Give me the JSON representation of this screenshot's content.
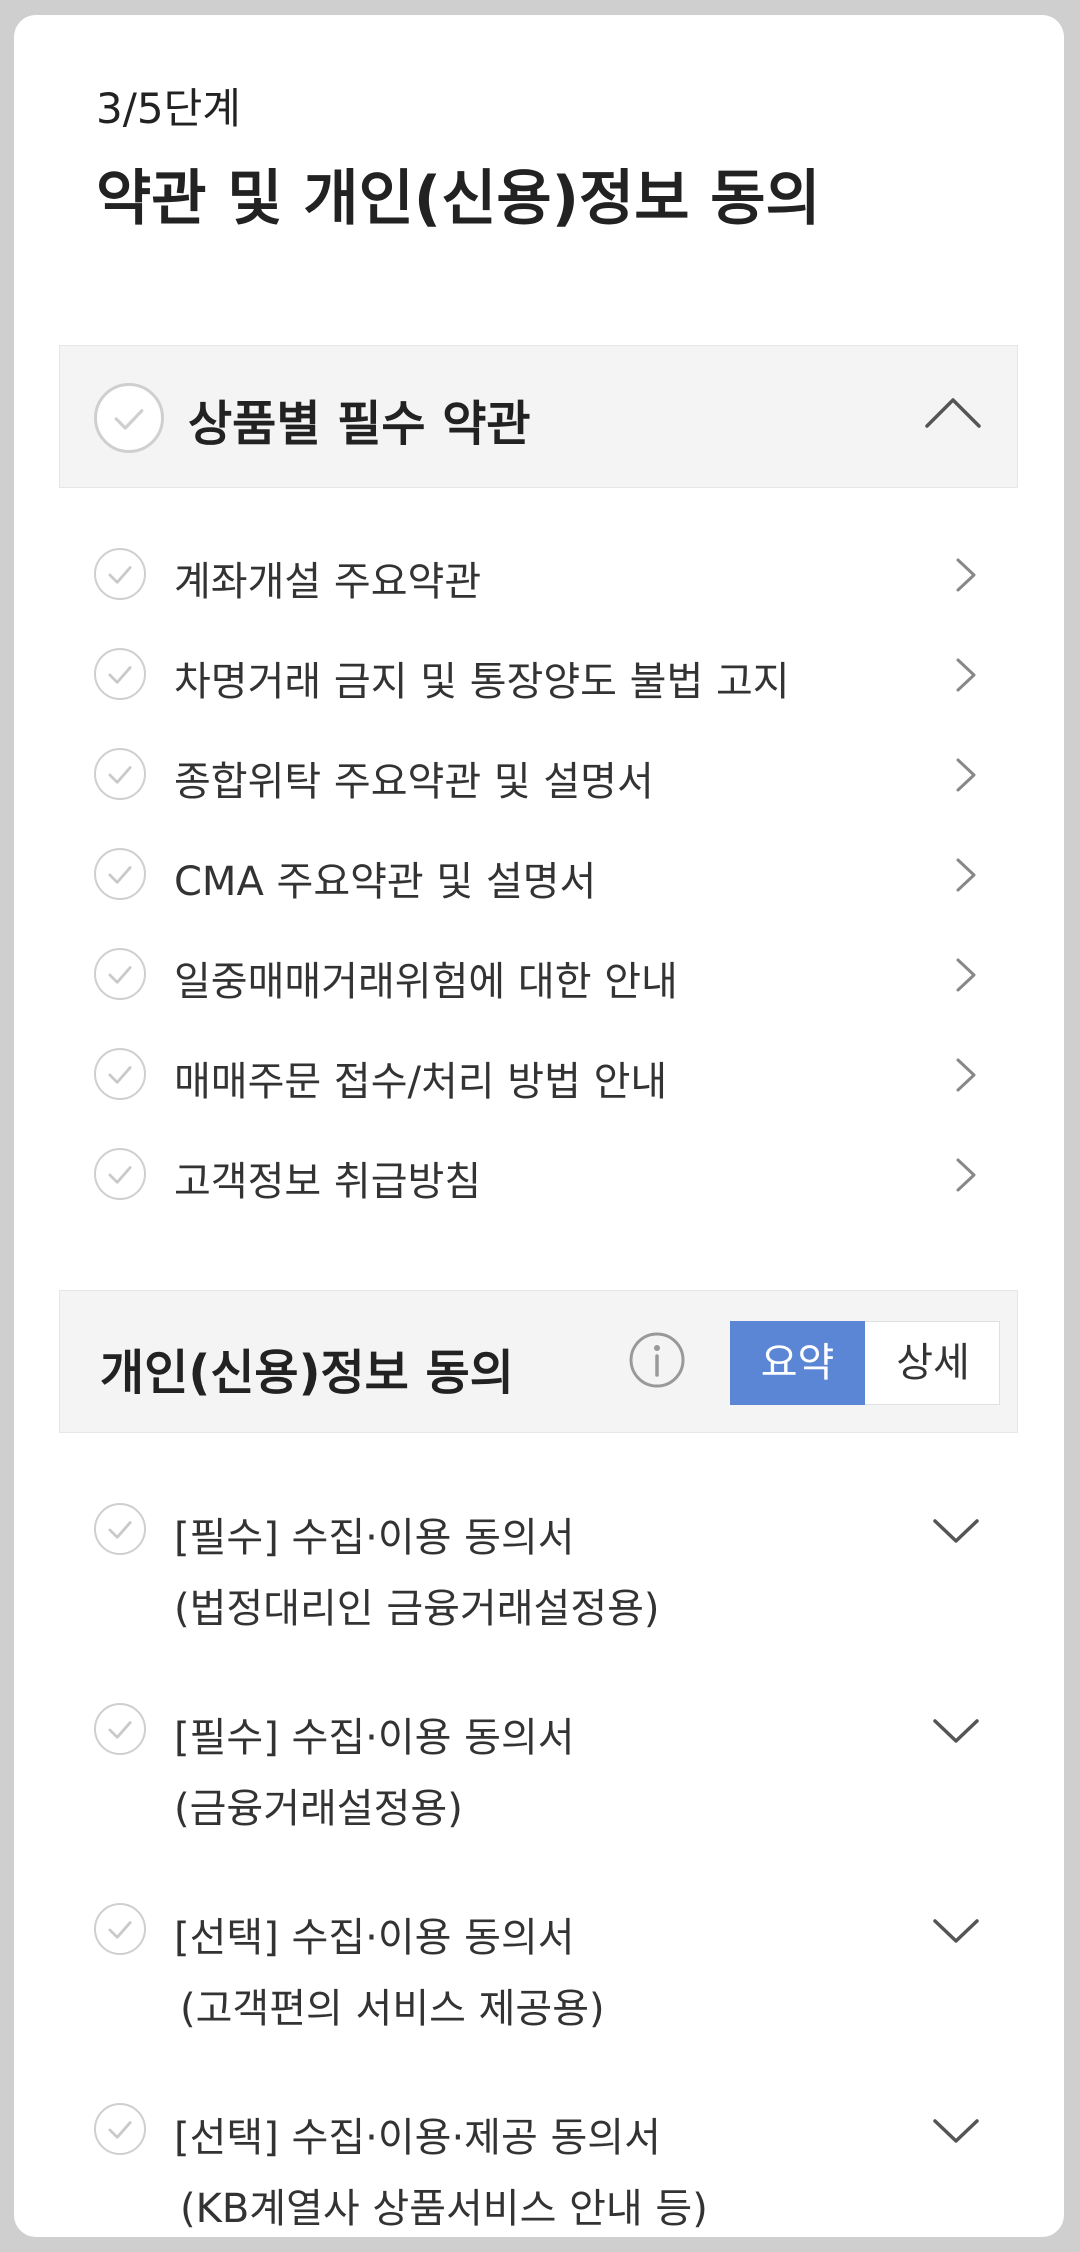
{
  "header": {
    "step": "3/5단계",
    "title": "약관 및 개인(신용)정보 동의"
  },
  "section1": {
    "title": "상품별 필수 약관",
    "items": [
      {
        "label": "계좌개설 주요약관"
      },
      {
        "label": "차명거래 금지 및 통장양도 불법 고지"
      },
      {
        "label": "종합위탁 주요약관 및 설명서"
      },
      {
        "label": "CMA 주요약관 및 설명서"
      },
      {
        "label": "일중매매거래위험에 대한 안내"
      },
      {
        "label": "매매주문 접수/처리 방법 안내"
      },
      {
        "label": "고객정보 취급방침"
      }
    ]
  },
  "section2": {
    "title": "개인(신용)정보 동의",
    "toggle": {
      "summary": "요약",
      "detail": "상세",
      "selected": "요약"
    },
    "items": [
      {
        "line1": "[필수] 수집·이용 동의서",
        "line2": "(법정대리인 금융거래설정용)"
      },
      {
        "line1": "[필수] 수집·이용 동의서",
        "line2": "(금융거래설정용)"
      },
      {
        "line1": "[선택] 수집·이용 동의서",
        "line2": "(고객편의 서비스 제공용)"
      },
      {
        "line1": "[선택] 수집·이용·제공 동의서",
        "line2": "(KB계열사 상품서비스 안내 등)"
      }
    ]
  },
  "colors": {
    "accent": "#5b86d6",
    "section_bg": "#f4f4f4",
    "check_gray": "#cfcfcf"
  },
  "icons": {
    "check": "check-icon",
    "collapse": "chevron-up-icon",
    "open": "chevron-right-icon",
    "expand": "chevron-down-icon",
    "info": "info-icon"
  }
}
